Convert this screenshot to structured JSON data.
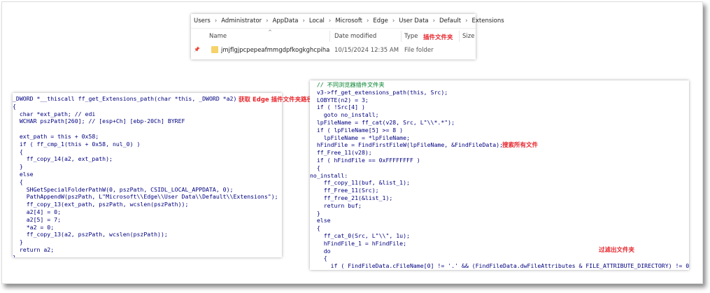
{
  "explorer": {
    "breadcrumb": [
      "Users",
      "Administrator",
      "AppData",
      "Local",
      "Microsoft",
      "Edge",
      "User Data",
      "Default",
      "Extensions"
    ],
    "columns": {
      "name": "Name",
      "date": "Date modified",
      "type": "Type",
      "size": "Size"
    },
    "annotation": "插件文件夹",
    "rows": [
      {
        "name": "jmjflgjpcpepeafmmgdpfkogkghcpiha",
        "date": "10/15/2024 12:35 AM",
        "type": "File folder"
      }
    ]
  },
  "left_code": {
    "annotation": "获取 Edge 插件文件夹路径",
    "lines": [
      "_DWORD *__thiscall ff_get_Extensions_path(char *this, _DWORD *a2)",
      "{",
      "  char *ext_path; // edi",
      "  WCHAR pszPath[260]; // [esp+Ch] [ebp-20Ch] BYREF",
      "",
      "  ext_path = this + 0x58;",
      "  if ( ff_cmp_1(this + 0x58, nul_0) )",
      "  {",
      "    ff_copy_14(a2, ext_path);",
      "  }",
      "  else",
      "  {",
      "    SHGetSpecialFolderPathW(0, pszPath, CSIDL_LOCAL_APPDATA, 0);",
      "    PathAppendW(pszPath, L\"Microsoft\\\\Edge\\\\User Data\\\\Default\\\\Extensions\");",
      "    ff_copy_13(ext_path, pszPath, wcslen(pszPath));",
      "    a2[4] = 0;",
      "    a2[5] = 7;",
      "    *a2 = 0;",
      "    ff_copy_13(a2, pszPath, wcslen(pszPath));",
      "  }",
      "  return a2;",
      "}"
    ]
  },
  "right_code": {
    "annotations": [
      "搜索所有文件",
      "过滤出文件夹"
    ],
    "lines": [
      "  // 不同浏览器插件文件夹",
      "  v3->ff_get_extensions_path(this, Src);",
      "  LOBYTE(n2) = 3;",
      "  if ( !Src[4] )",
      "    goto no_install;",
      "  lpFileName = ff_cat(v28, Src, L\"\\\\*.*\");",
      "  if ( lpFileName[5] >= 8 )",
      "    lpFileName = *lpFileName;",
      "  hFindFile = FindFirstFileW(lpFileName, &FindFileData);",
      "  ff_Free_11(v28);",
      "  if ( hFindFile == 0xFFFFFFFF )",
      "  {",
      "no_install:",
      "    ff_copy_11(buf, &list_1);",
      "    ff_Free_11(Src);",
      "    ff_free_21(&list_1);",
      "    return buf;",
      "  }",
      "  else",
      "  {",
      "    ff_cat_0(Src, L\"\\\\\", 1u);",
      "    hFindFile_1 = hFindFile;",
      "    do",
      "    {",
      "      if ( FindFileData.cFileName[0] != '.' && (FindFileData.dwFileAttributes & FILE_ATTRIBUTE_DIRECTORY) != 0 )",
      "      {"
    ]
  }
}
